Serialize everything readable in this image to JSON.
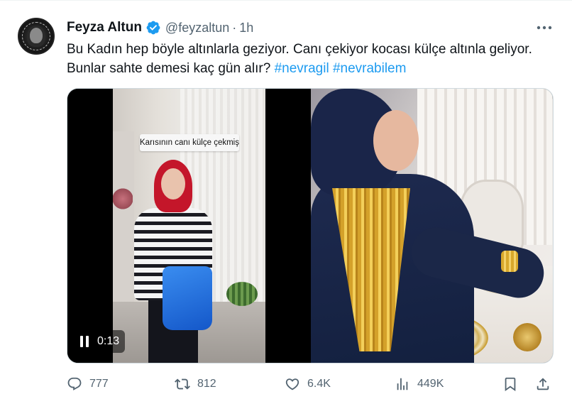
{
  "author": {
    "display_name": "Feyza Altun",
    "handle": "@feyzaltun",
    "separator": "·",
    "time": "1h",
    "avatar_icon": "profile-photo",
    "verified_icon": "verified-badge-icon",
    "verified_color": "#1d9bf0"
  },
  "tweet": {
    "text": "Bu Kadın hep böyle altınlarla geziyor. Canı çekiyor kocası külçe altınla geliyor. Bunlar sahte demesi kaç gün alır?",
    "hashtags": [
      "#nevragil",
      "#nevrabilem"
    ],
    "hashtag_color": "#1d9bf0"
  },
  "media": {
    "video": {
      "caption": "Karısının canı külçe çekmiş",
      "timestamp": "0:13",
      "state": "playing"
    }
  },
  "actions": {
    "reply": {
      "count": "777",
      "icon": "reply-icon"
    },
    "retweet": {
      "count": "812",
      "icon": "retweet-icon"
    },
    "like": {
      "count": "6.4K",
      "icon": "heart-icon"
    },
    "views": {
      "count": "449K",
      "icon": "analytics-icon"
    },
    "bookmark": {
      "icon": "bookmark-icon"
    },
    "share": {
      "icon": "share-icon"
    }
  },
  "colors": {
    "text": "#0f1419",
    "secondary": "#536471",
    "accent": "#1d9bf0"
  }
}
